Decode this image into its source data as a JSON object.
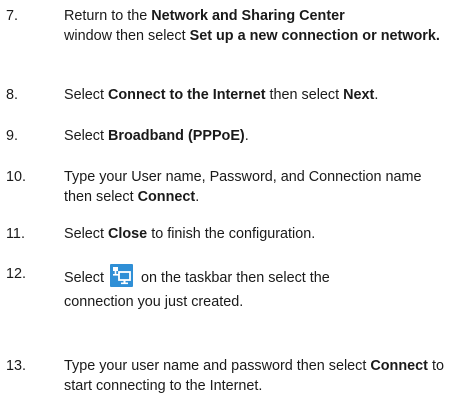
{
  "steps": [
    {
      "number": "7.",
      "p1": "Return to the ",
      "b1": "Network and Sharing Center",
      "p2": " window then select ",
      "b2": "Set up a new connection or network."
    },
    {
      "number": "8.",
      "p1": "Select ",
      "b1": "Connect to the Internet",
      "p2": " then select ",
      "b2": "Next",
      "p3": "."
    },
    {
      "number": "9.",
      "p1": "Select ",
      "b1": "Broadband (PPPoE)",
      "p2": "."
    },
    {
      "number": "10.",
      "p1": "Type your User name, Password, and Connection name then select ",
      "b1": "Connect",
      "p2": "."
    },
    {
      "number": "11.",
      "p1": "Select ",
      "b1": "Close",
      "p2": " to finish the configuration."
    },
    {
      "number": "12.",
      "p1": "Select ",
      "icon": "network-taskbar-icon",
      "p2": " on the taskbar then select the",
      "p3": "connection you just created."
    },
    {
      "number": "13.",
      "p1": "Type your user name and password then select ",
      "b1": "Connect",
      "p2": " to start connecting to the Internet."
    }
  ],
  "colors": {
    "text": "#1a1a1a",
    "icon_background": "#2f8fd6",
    "icon_glyph": "#ffffff"
  }
}
